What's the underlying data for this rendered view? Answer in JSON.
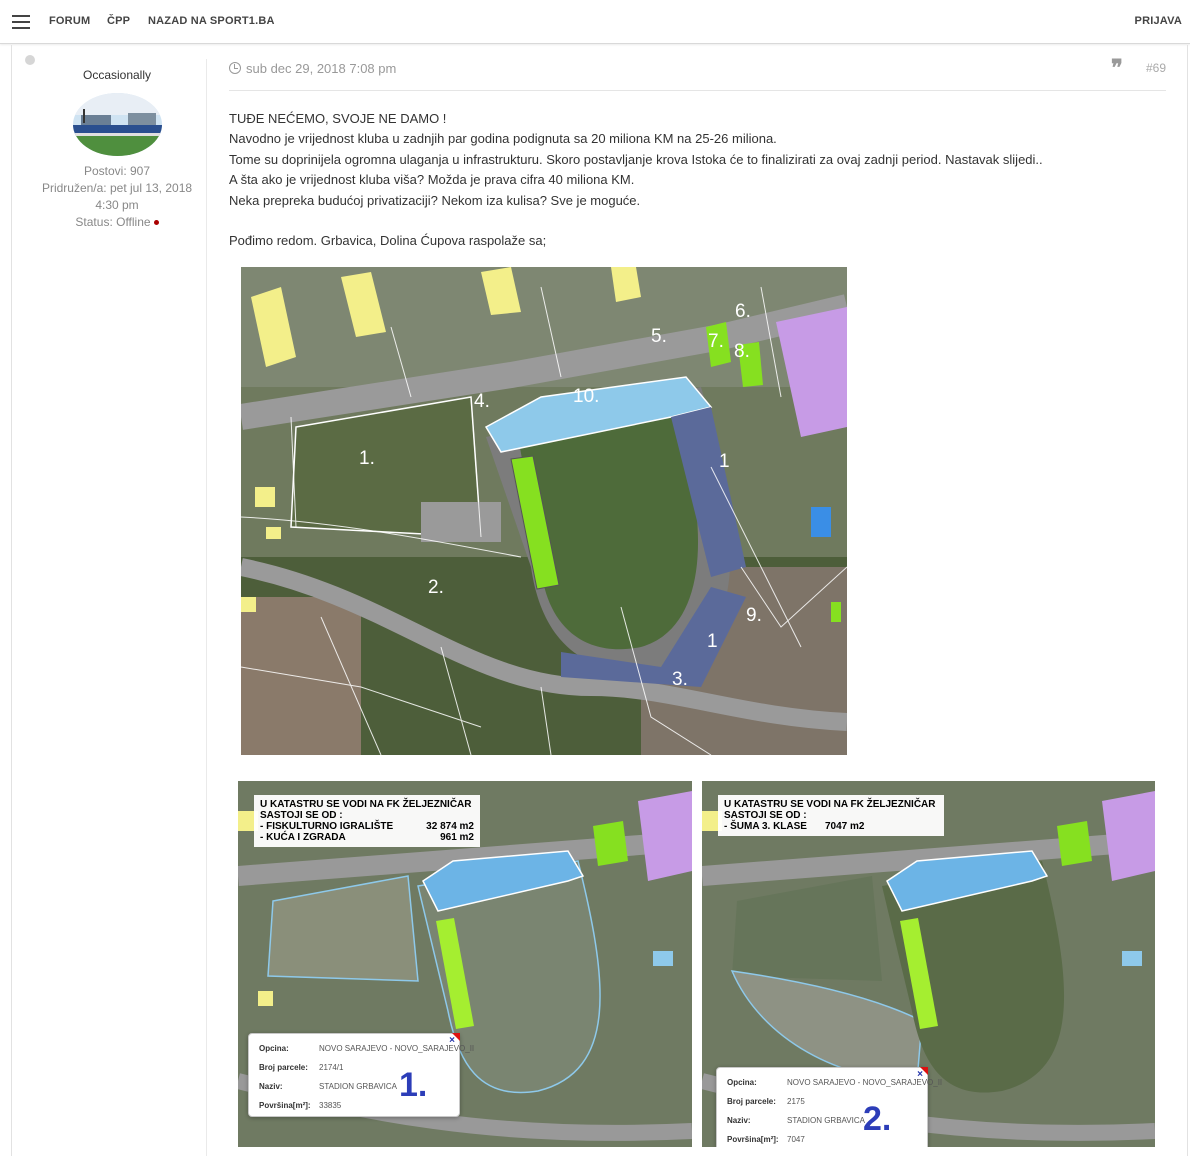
{
  "nav": {
    "menu_icon": "hamburger-menu-icon",
    "forum": "FORUM",
    "cpp": "ČPP",
    "sport": "NAZAD NA SPORT1.BA",
    "login": "PRIJAVA"
  },
  "author": {
    "username": "Occasionally",
    "posts": "Postovi: 907",
    "joined": "Pridružen/a: pet jul 13, 2018",
    "joined_time": "4:30 pm",
    "status": "Status: Offline"
  },
  "post": {
    "date": "sub dec 29, 2018 7:08 pm",
    "number": "#69",
    "lines": [
      "TUĐE NEĆEMO, SVOJE NE DAMO !",
      "Navodno je vrijednost kluba u zadnjih par godina podignuta sa 20 miliona KM na 25-26 miliona.",
      "Tome su doprinijela ogromna ulaganja u infrastrukturu. Skoro postavljanje krova Istoka će to finalizirati za ovaj zadnji period. Nastavak slijedi..",
      "A šta ako je vrijednost kluba viša? Možda je prava cifra 40 miliona KM.",
      "Neka prepreka budućoj privatizaciji? Nekom iza kulisa? Sve je moguće.",
      "",
      "Pođimo redom. Grbavica, Dolina Ćupova raspolaže sa;"
    ]
  },
  "map_main": {
    "labels": [
      "1.",
      "2.",
      "3.",
      "4.",
      "5.",
      "6.",
      "7.",
      "8.",
      "9.",
      "10.",
      "1",
      "1"
    ]
  },
  "map_left": {
    "title1": "U KATASTRU SE VODI NA FK ŽELJEZNIČAR",
    "title2": "SASTOJI SE OD :",
    "item1_name": "- FISKULTURNO IGRALIŠTE",
    "item1_val": "32 874 m2",
    "item2_name": "- KUĆA I ZGRADA",
    "item2_val": "961 m2",
    "popup": {
      "opcina_lbl": "Opcina:",
      "opcina_val": "NOVO SARAJEVO - NOVO_SARAJEVO_II",
      "parcela_lbl": "Broj parcele:",
      "parcela_val": "2174/1",
      "naziv_lbl": "Naziv:",
      "naziv_val": "STADION GRBAVICA",
      "povrsina_lbl": "Površina[m²]:",
      "povrsina_val": "33835",
      "big": "1.",
      "close": "×"
    }
  },
  "map_right": {
    "title1": "U KATASTRU SE VODI NA FK ŽELJEZNIČAR",
    "title2": "SASTOJI SE OD :",
    "item1_name": "- ŠUMA 3. KLASE",
    "item1_val": "7047 m2",
    "popup": {
      "opcina_lbl": "Opcina:",
      "opcina_val": "NOVO SARAJEVO - NOVO_SARAJEVO_II",
      "parcela_lbl": "Broj parcele:",
      "parcela_val": "2175",
      "naziv_lbl": "Naziv:",
      "naziv_val": "STADION GRBAVICA",
      "povrsina_lbl": "Površina[m²]:",
      "povrsina_val": "7047",
      "big": "2.",
      "close": "×"
    }
  },
  "colors": {
    "pitch": "#4e6b3a",
    "stand_blue": "#8ec9ea",
    "stand_green": "#86e020",
    "purple": "#c79be6",
    "yellow": "#f3ef8a"
  }
}
